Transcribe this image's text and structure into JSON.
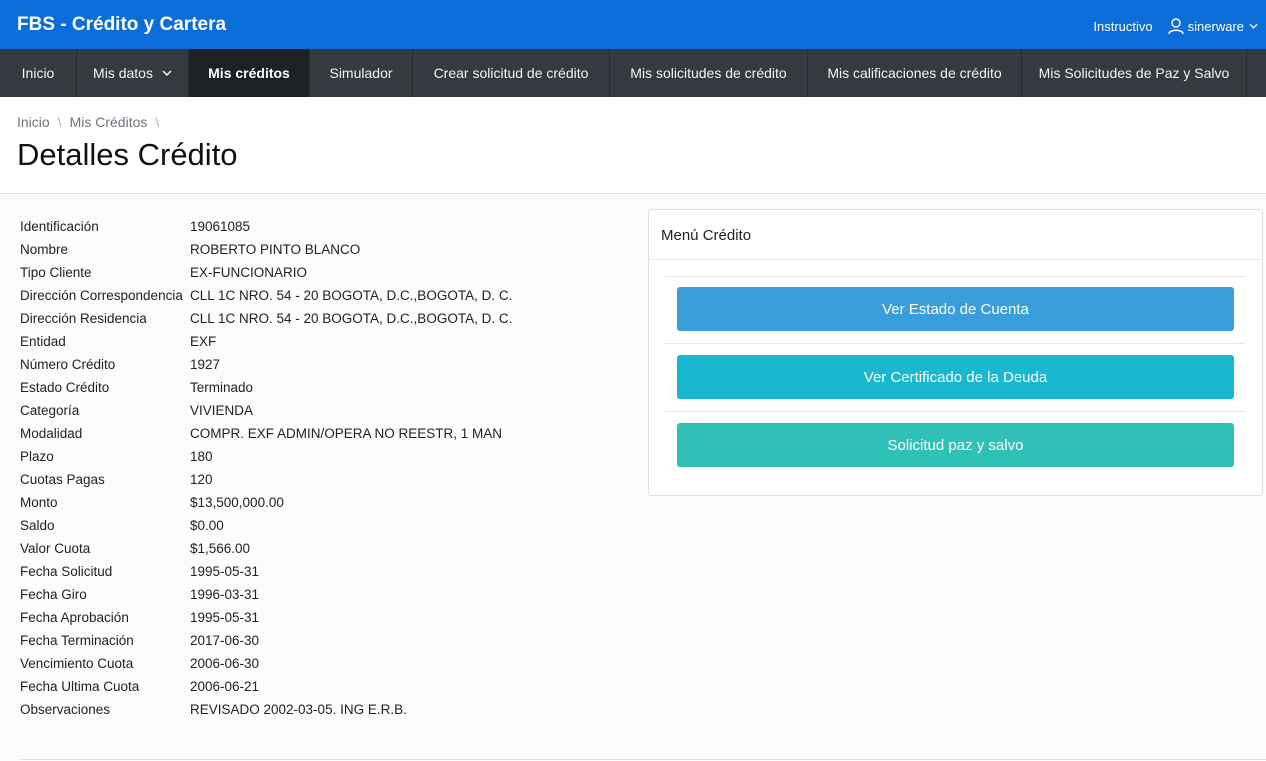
{
  "app": {
    "title": "FBS - Crédito y Cartera"
  },
  "topbar": {
    "instructivo": "Instructivo",
    "username": "sinerware",
    "brand_color": "#0b6ed8"
  },
  "nav": {
    "items": [
      {
        "label": "Inicio"
      },
      {
        "label": "Mis datos",
        "has_dropdown": true
      },
      {
        "label": "Mis créditos",
        "active": true
      },
      {
        "label": "Simulador"
      },
      {
        "label": "Crear solicitud de crédito"
      },
      {
        "label": "Mis solicitudes de crédito"
      },
      {
        "label": "Mis calificaciones de crédito"
      },
      {
        "label": "Mis Solicitudes de Paz y Salvo"
      }
    ]
  },
  "breadcrumb": {
    "items": [
      "Inicio",
      "Mis Créditos"
    ],
    "separator": "\\"
  },
  "page": {
    "title": "Detalles Crédito"
  },
  "details": [
    {
      "label": "Identificación",
      "value": "19061085"
    },
    {
      "label": "Nombre",
      "value": "ROBERTO PINTO BLANCO"
    },
    {
      "label": "Tipo Cliente",
      "value": "EX-FUNCIONARIO"
    },
    {
      "label": "Dirección Correspondencia",
      "value": "CLL 1C NRO. 54 - 20 BOGOTA, D.C.,BOGOTA, D. C."
    },
    {
      "label": "Dirección Residencia",
      "value": "CLL 1C NRO. 54 - 20 BOGOTA, D.C.,BOGOTA, D. C."
    },
    {
      "label": "Entidad",
      "value": "EXF"
    },
    {
      "label": "Número Crédito",
      "value": "1927"
    },
    {
      "label": "Estado Crédito",
      "value": "Terminado"
    },
    {
      "label": "Categoría",
      "value": "VIVIENDA"
    },
    {
      "label": "Modalidad",
      "value": "COMPR. EXF ADMIN/OPERA NO REESTR, 1 MAN"
    },
    {
      "label": "Plazo",
      "value": "180"
    },
    {
      "label": "Cuotas Pagas",
      "value": "120"
    },
    {
      "label": "Monto",
      "value": "$13,500,000.00"
    },
    {
      "label": "Saldo",
      "value": "$0.00"
    },
    {
      "label": "Valor Cuota",
      "value": "$1,566.00"
    },
    {
      "label": "Fecha Solicitud",
      "value": "1995-05-31"
    },
    {
      "label": "Fecha Giro",
      "value": "1996-03-31"
    },
    {
      "label": "Fecha Aprobación",
      "value": "1995-05-31"
    },
    {
      "label": "Fecha Terminación",
      "value": "2017-06-30"
    },
    {
      "label": "Vencimiento Cuota",
      "value": "2006-06-30"
    },
    {
      "label": "Fecha Ultima Cuota",
      "value": "2006-06-21"
    },
    {
      "label": "Observaciones",
      "value": "REVISADO 2002-03-05. ING E.R.B."
    }
  ],
  "menu": {
    "title": "Menú Crédito",
    "buttons": [
      {
        "label": "Ver Estado de Cuenta",
        "color": "#3a9edc"
      },
      {
        "label": "Ver Certificado de la Deuda",
        "color": "#17b8d0"
      },
      {
        "label": "Solicitud paz y salvo",
        "color": "#2fc0b8"
      }
    ]
  }
}
